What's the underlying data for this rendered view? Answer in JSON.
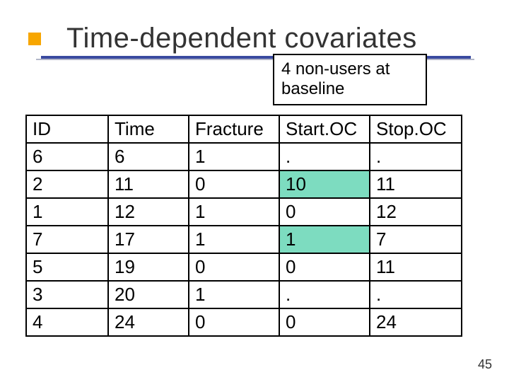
{
  "title": "Time-dependent covariates",
  "callout": "4 non-users at baseline",
  "columns": [
    "ID",
    "Time",
    "Fracture",
    "Start.OC",
    "Stop.OC"
  ],
  "rows": [
    {
      "id": "6",
      "time": "6",
      "fracture": "1",
      "startoc": ".",
      "stopoc": ".",
      "hl": false
    },
    {
      "id": "2",
      "time": "11",
      "fracture": "0",
      "startoc": "10",
      "stopoc": "11",
      "hl": true
    },
    {
      "id": "1",
      "time": "12",
      "fracture": "1",
      "startoc": "0",
      "stopoc": "12",
      "hl": false
    },
    {
      "id": "7",
      "time": "17",
      "fracture": "1",
      "startoc": "1",
      "stopoc": "7",
      "hl": true
    },
    {
      "id": "5",
      "time": "19",
      "fracture": "0",
      "startoc": "0",
      "stopoc": "11",
      "hl": false
    },
    {
      "id": "3",
      "time": "20",
      "fracture": "1",
      "startoc": ".",
      "stopoc": ".",
      "hl": false
    },
    {
      "id": "4",
      "time": "24",
      "fracture": "0",
      "startoc": "0",
      "stopoc": "24",
      "hl": false
    }
  ],
  "highlight_color": "#7ddcc0",
  "page_number": "45"
}
